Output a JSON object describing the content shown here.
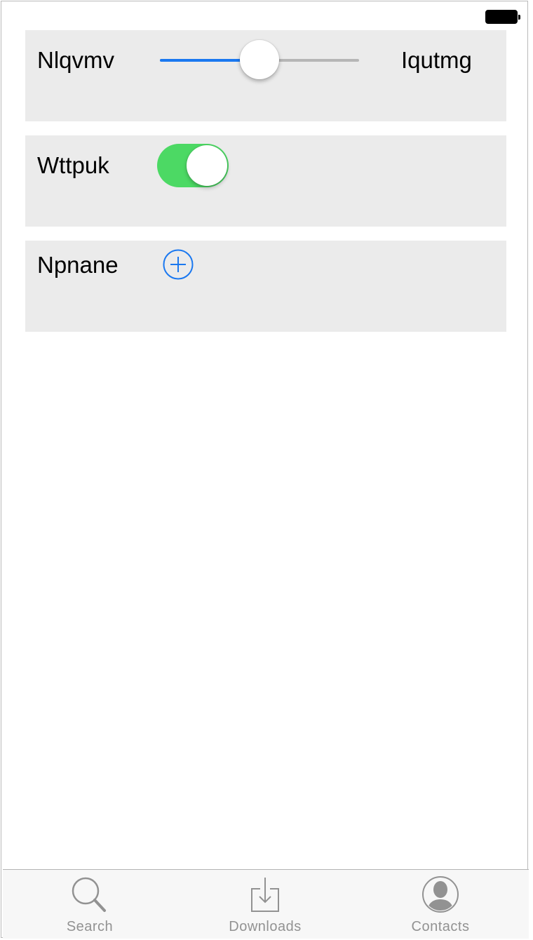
{
  "status_bar": {
    "battery_icon": "battery-full-icon"
  },
  "rows": {
    "slider_row": {
      "label_left": "Nlqvmv",
      "label_right": "Iqutmg",
      "slider_value_fraction": 0.5,
      "accent_color": "#1a78f0"
    },
    "toggle_row": {
      "label": "Wttpuk",
      "toggle_on": true,
      "on_color": "#4cd964"
    },
    "add_row": {
      "label": "Npnane",
      "add_icon": "plus-circle-icon"
    }
  },
  "tabbar": {
    "tabs": [
      {
        "label": "Search",
        "icon": "search-icon"
      },
      {
        "label": "Downloads",
        "icon": "download-icon"
      },
      {
        "label": "Contacts",
        "icon": "contacts-icon"
      }
    ]
  }
}
